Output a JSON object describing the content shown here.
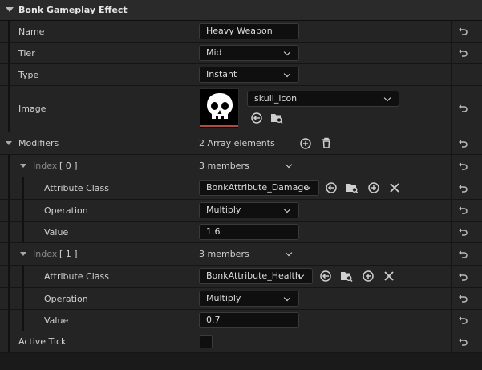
{
  "header": {
    "title": "Bonk Gameplay Effect"
  },
  "name": {
    "label": "Name",
    "value": "Heavy Weapon"
  },
  "tier": {
    "label": "Tier",
    "value": "Mid"
  },
  "type": {
    "label": "Type",
    "value": "Instant"
  },
  "image": {
    "label": "Image",
    "value": "skull_icon",
    "thumbnail_icon": "skull-icon"
  },
  "modifiers": {
    "label": "Modifiers",
    "count_text": "2 Array elements",
    "items": [
      {
        "index_label": "Index",
        "index_value": "[ 0 ]",
        "members_text": "3 members",
        "attribute_class_label": "Attribute Class",
        "attribute_class_value": "BonkAttribute_Damage",
        "operation_label": "Operation",
        "operation_value": "Multiply",
        "value_label": "Value",
        "value": "1.6"
      },
      {
        "index_label": "Index",
        "index_value": "[ 1 ]",
        "members_text": "3 members",
        "attribute_class_label": "Attribute Class",
        "attribute_class_value": "BonkAttribute_Health",
        "operation_label": "Operation",
        "operation_value": "Multiply",
        "value_label": "Value",
        "value": "0.7"
      }
    ]
  },
  "active_tick": {
    "label": "Active Tick",
    "checked": false
  },
  "colors": {
    "panel": "#242424",
    "field": "#0f0f0f",
    "accent_red": "#b24a44"
  }
}
